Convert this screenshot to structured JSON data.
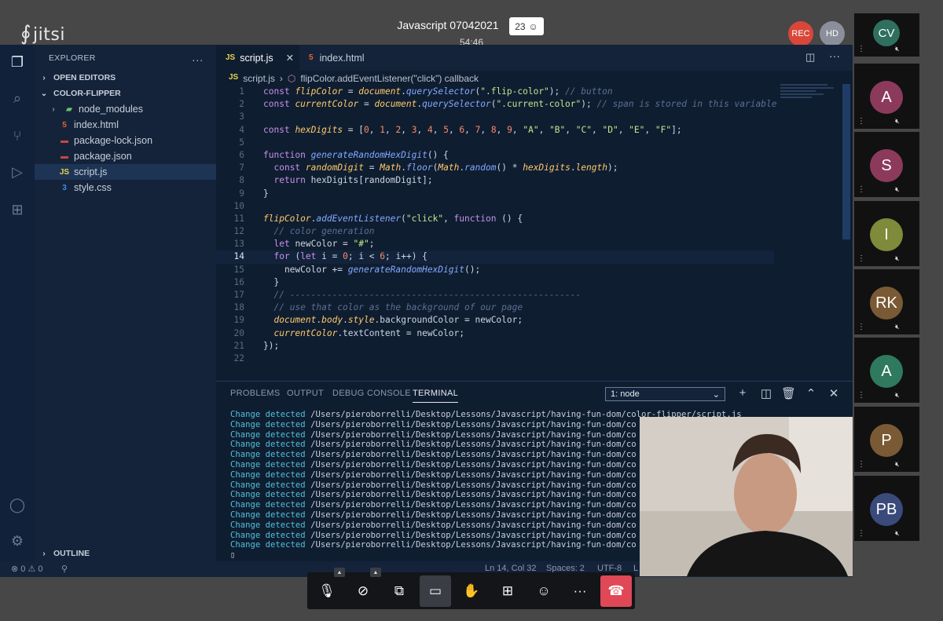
{
  "meeting": {
    "logo_text": "jitsi",
    "title": "Javascript 07042021",
    "timer": "54:46",
    "participant_count": "23",
    "rec_label": "REC",
    "hd_label": "HD"
  },
  "sidebar": {
    "explorer_title": "EXPLORER",
    "open_editors": "OPEN EDITORS",
    "project": "COLOR-FLIPPER",
    "outline": "OUTLINE",
    "files": [
      {
        "name": "node_modules",
        "icon": "folder-icon"
      },
      {
        "name": "index.html",
        "icon": "html-icon"
      },
      {
        "name": "package-lock.json",
        "icon": "npm-icon"
      },
      {
        "name": "package.json",
        "icon": "npm-icon"
      },
      {
        "name": "script.js",
        "icon": "js-icon"
      },
      {
        "name": "style.css",
        "icon": "css-icon"
      }
    ]
  },
  "editor": {
    "tabs": [
      {
        "label": "script.js",
        "badge": "JS"
      },
      {
        "label": "index.html",
        "badge": "5"
      }
    ],
    "breadcrumb_file": "script.js",
    "breadcrumb_symbol": "flipColor.addEventListener(\"click\") callback",
    "current_line": 14
  },
  "panel": {
    "tabs": [
      "PROBLEMS",
      "OUTPUT",
      "DEBUG CONSOLE",
      "TERMINAL"
    ],
    "active_tab": "TERMINAL",
    "terminal_select": "1: node",
    "lines": [
      {
        "prefix": "Change detected",
        "path": "/Users/pieroborrelli/Desktop/Lessons/Javascript/having-fun-dom/color-flipper/script.js"
      },
      {
        "prefix": "Change detected",
        "path": "/Users/pieroborrelli/Desktop/Lessons/Javascript/having-fun-dom/co"
      },
      {
        "prefix": "Change detected",
        "path": "/Users/pieroborrelli/Desktop/Lessons/Javascript/having-fun-dom/co"
      },
      {
        "prefix": "Change detected",
        "path": "/Users/pieroborrelli/Desktop/Lessons/Javascript/having-fun-dom/co"
      },
      {
        "prefix": "Change detected",
        "path": "/Users/pieroborrelli/Desktop/Lessons/Javascript/having-fun-dom/co"
      },
      {
        "prefix": "Change detected",
        "path": "/Users/pieroborrelli/Desktop/Lessons/Javascript/having-fun-dom/co"
      },
      {
        "prefix": "Change detected",
        "path": "/Users/pieroborrelli/Desktop/Lessons/Javascript/having-fun-dom/co"
      },
      {
        "prefix": "Change detected",
        "path": "/Users/pieroborrelli/Desktop/Lessons/Javascript/having-fun-dom/co"
      },
      {
        "prefix": "Change detected",
        "path": "/Users/pieroborrelli/Desktop/Lessons/Javascript/having-fun-dom/co"
      },
      {
        "prefix": "Change detected",
        "path": "/Users/pieroborrelli/Desktop/Lessons/Javascript/having-fun-dom/co"
      },
      {
        "prefix": "Change detected",
        "path": "/Users/pieroborrelli/Desktop/Lessons/Javascript/having-fun-dom/co"
      },
      {
        "prefix": "Change detected",
        "path": "/Users/pieroborrelli/Desktop/Lessons/Javascript/having-fun-dom/co"
      },
      {
        "prefix": "Change detected",
        "path": "/Users/pieroborrelli/Desktop/Lessons/Javascript/having-fun-dom/co"
      },
      {
        "prefix": "Change detected",
        "path": "/Users/pieroborrelli/Desktop/Lessons/Javascript/having-fun-dom/co"
      }
    ]
  },
  "statusbar": {
    "problems": "⊗ 0 ⚠ 0",
    "position": "Ln 14, Col 32",
    "spaces": "Spaces: 2",
    "encoding": "UTF-8",
    "eol": "L"
  },
  "participants": [
    {
      "initials": "CV",
      "color": "#2f6f5e"
    },
    {
      "initials": "A",
      "color": "#8c3a5c"
    },
    {
      "initials": "S",
      "color": "#8c3a5c"
    },
    {
      "initials": "I",
      "color": "#7f8a3a"
    },
    {
      "initials": "RK",
      "color": "#7a5a35"
    },
    {
      "initials": "A",
      "color": "#2f7a5e"
    },
    {
      "initials": "P",
      "color": "#7a5a35"
    },
    {
      "initials": "PB",
      "color": "#3a4a7a"
    }
  ],
  "colors": {
    "hangup": "#e04757",
    "rec": "#d9463a"
  }
}
